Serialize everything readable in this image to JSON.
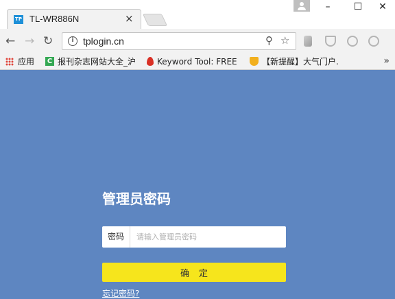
{
  "window": {
    "minimize_glyph": "–",
    "maximize_glyph": "☐",
    "close_glyph": "✕"
  },
  "tab": {
    "favicon_text": "TP",
    "title": "TL-WR886N",
    "close_glyph": "×"
  },
  "toolbar": {
    "back_glyph": "←",
    "forward_glyph": "→",
    "reload_glyph": "↻",
    "url": "tplogin.cn",
    "zoom_glyph": "⚲",
    "star_glyph": "☆"
  },
  "bookmarks": {
    "items": [
      {
        "label": "应用",
        "icon": "apps-grid-icon"
      },
      {
        "label": "报刊杂志网站大全_沪",
        "icon": "c-logo-icon",
        "icon_color": "#34a853"
      },
      {
        "label": "Keyword Tool: FREE",
        "icon": "flame-icon",
        "icon_color": "#d93025"
      },
      {
        "label": "【新提醒】大气门户.",
        "icon": "trophy-icon",
        "icon_color": "#f2b01e"
      }
    ],
    "more_glyph": "»"
  },
  "login": {
    "title": "管理员密码",
    "password_label": "密码",
    "password_placeholder": "请输入管理员密码",
    "password_value": "",
    "confirm_label": "确定",
    "forgot_link": "忘记密码?"
  },
  "colors": {
    "page_background": "#5e86c1",
    "confirm_button": "#f6e51c"
  }
}
